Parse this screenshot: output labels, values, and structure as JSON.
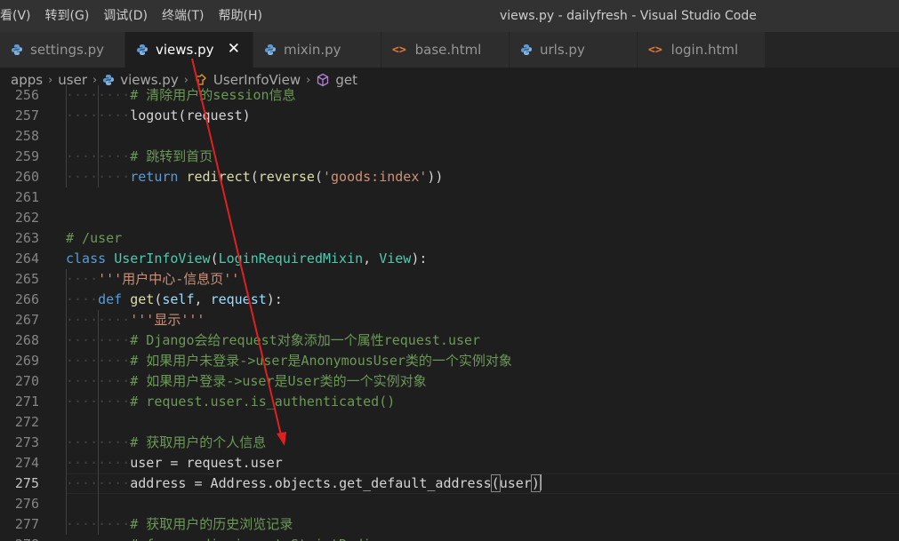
{
  "menu": [
    "看(V)",
    "转到(G)",
    "调试(D)",
    "终端(T)",
    "帮助(H)"
  ],
  "window_title": "views.py - dailyfresh - Visual Studio Code",
  "tabs": [
    {
      "label": "settings.py",
      "icon": "python-icon",
      "active": false,
      "width": 141
    },
    {
      "label": "views.py",
      "icon": "python-icon",
      "active": true,
      "width": 144
    },
    {
      "label": "mixin.py",
      "icon": "python-icon",
      "active": false,
      "width": 144
    },
    {
      "label": "base.html",
      "icon": "html-icon",
      "active": false,
      "width": 144
    },
    {
      "label": "urls.py",
      "icon": "python-icon",
      "active": false,
      "width": 144
    },
    {
      "label": "login.html",
      "icon": "html-icon",
      "active": false,
      "width": 144
    }
  ],
  "tab_close_glyph": "✕",
  "html_glyph": "<>",
  "breadcrumb": {
    "parts": [
      "apps",
      "user",
      "views.py",
      "UserInfoView",
      "get"
    ],
    "separator": "›"
  },
  "editor": {
    "current_line": 275,
    "lines": [
      {
        "num": "256",
        "indent": 2,
        "tokens": [
          {
            "t": "# 清除用户的session信息",
            "c": "c-com"
          }
        ]
      },
      {
        "num": "257",
        "indent": 2,
        "tokens": [
          {
            "t": "logout(request)",
            "c": "c-def"
          }
        ]
      },
      {
        "num": "258",
        "indent": 0,
        "tokens": []
      },
      {
        "num": "259",
        "indent": 2,
        "tokens": [
          {
            "t": "# 跳转到首页",
            "c": "c-com"
          }
        ]
      },
      {
        "num": "260",
        "indent": 2,
        "tokens": [
          {
            "t": "return",
            "c": "c-kw"
          },
          {
            "t": " ",
            "c": "c-def"
          },
          {
            "t": "redirect",
            "c": "c-fn"
          },
          {
            "t": "(",
            "c": "c-def"
          },
          {
            "t": "reverse",
            "c": "c-fn"
          },
          {
            "t": "(",
            "c": "c-def"
          },
          {
            "t": "'goods:index'",
            "c": "c-str"
          },
          {
            "t": "))",
            "c": "c-def"
          }
        ]
      },
      {
        "num": "261",
        "indent": 0,
        "tokens": []
      },
      {
        "num": "262",
        "indent": 0,
        "tokens": []
      },
      {
        "num": "263",
        "indent": 0,
        "tokens": [
          {
            "t": "# /user",
            "c": "c-com"
          }
        ]
      },
      {
        "num": "264",
        "indent": 0,
        "tokens": [
          {
            "t": "class",
            "c": "c-kw"
          },
          {
            "t": " ",
            "c": "c-def"
          },
          {
            "t": "UserInfoView",
            "c": "c-cls"
          },
          {
            "t": "(",
            "c": "c-def"
          },
          {
            "t": "LoginRequiredMixin",
            "c": "c-cls"
          },
          {
            "t": ", ",
            "c": "c-def"
          },
          {
            "t": "View",
            "c": "c-cls"
          },
          {
            "t": "):",
            "c": "c-def"
          }
        ]
      },
      {
        "num": "265",
        "indent": 1,
        "tokens": [
          {
            "t": "'''用户中心-信息页'''",
            "c": "c-str"
          }
        ]
      },
      {
        "num": "266",
        "indent": 1,
        "tokens": [
          {
            "t": "def",
            "c": "c-kw"
          },
          {
            "t": " ",
            "c": "c-def"
          },
          {
            "t": "get",
            "c": "c-fn"
          },
          {
            "t": "(",
            "c": "c-def"
          },
          {
            "t": "self",
            "c": "c-var"
          },
          {
            "t": ", ",
            "c": "c-def"
          },
          {
            "t": "request",
            "c": "c-var"
          },
          {
            "t": "):",
            "c": "c-def"
          }
        ]
      },
      {
        "num": "267",
        "indent": 2,
        "tokens": [
          {
            "t": "'''显示'''",
            "c": "c-str"
          }
        ]
      },
      {
        "num": "268",
        "indent": 2,
        "tokens": [
          {
            "t": "# Django会给request对象添加一个属性request.user",
            "c": "c-com"
          }
        ]
      },
      {
        "num": "269",
        "indent": 2,
        "tokens": [
          {
            "t": "# 如果用户未登录->user是AnonymousUser类的一个实例对象",
            "c": "c-com"
          }
        ]
      },
      {
        "num": "270",
        "indent": 2,
        "tokens": [
          {
            "t": "# 如果用户登录->user是User类的一个实例对象",
            "c": "c-com"
          }
        ]
      },
      {
        "num": "271",
        "indent": 2,
        "tokens": [
          {
            "t": "# request.user.is_authenticated()",
            "c": "c-com"
          }
        ]
      },
      {
        "num": "272",
        "indent": 0,
        "tokens": []
      },
      {
        "num": "273",
        "indent": 2,
        "tokens": [
          {
            "t": "# 获取用户的个人信息",
            "c": "c-com"
          }
        ]
      },
      {
        "num": "274",
        "indent": 2,
        "tokens": [
          {
            "t": "user = request.user",
            "c": "c-def"
          }
        ]
      },
      {
        "num": "275",
        "indent": 2,
        "tokens": [
          {
            "t": "address = Address.objects.",
            "c": "c-def"
          },
          {
            "t": "get_default_address",
            "c": "c-def"
          },
          {
            "t": "(",
            "c": "c-def",
            "match": true
          },
          {
            "t": "user",
            "c": "c-def"
          },
          {
            "t": ")",
            "c": "c-def",
            "match": true
          },
          {
            "t": "",
            "c": "c-def",
            "cursor": true
          }
        ]
      },
      {
        "num": "276",
        "indent": 0,
        "tokens": []
      },
      {
        "num": "277",
        "indent": 2,
        "tokens": [
          {
            "t": "# 获取用户的历史浏览记录",
            "c": "c-com"
          }
        ]
      },
      {
        "num": "278",
        "indent": 2,
        "tokens": [
          {
            "t": "# from redis import StrictRedis",
            "c": "c-com"
          }
        ]
      }
    ]
  },
  "colors": {
    "accent": "#007acc",
    "annotation_arrow": "#e02020"
  }
}
